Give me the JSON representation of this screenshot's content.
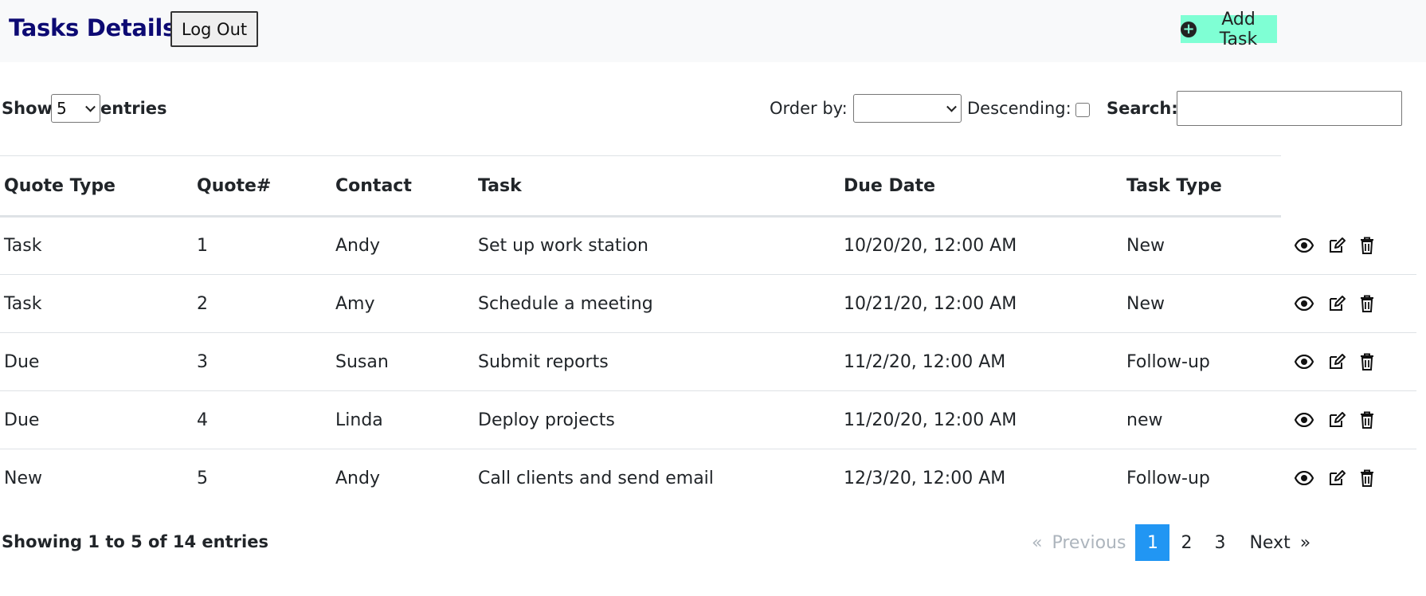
{
  "header": {
    "title": "Tasks Details",
    "logout_label": "Log Out",
    "add_task_label": "Add Task",
    "add_task_color": "#7fffd4",
    "title_color": "#0d0a73"
  },
  "controls": {
    "show_label": "Show",
    "entries_value": "5",
    "entries_label": "entries",
    "order_by_label": "Order by:",
    "order_by_value": "",
    "descending_label": "Descending:",
    "descending_checked": false,
    "search_label": "Search:",
    "search_value": ""
  },
  "table": {
    "columns": [
      "Quote Type",
      "Quote#",
      "Contact",
      "Task",
      "Due Date",
      "Task Type"
    ],
    "rows": [
      [
        "Task",
        "1",
        "Andy",
        "Set up work station",
        "10/20/20, 12:00 AM",
        "New"
      ],
      [
        "Task",
        "2",
        "Amy",
        "Schedule a meeting",
        "10/21/20, 12:00 AM",
        "New"
      ],
      [
        "Due",
        "3",
        "Susan",
        "Submit reports",
        "11/2/20, 12:00 AM",
        "Follow-up"
      ],
      [
        "Due",
        "4",
        "Linda",
        "Deploy projects",
        "11/20/20, 12:00 AM",
        "new"
      ],
      [
        "New",
        "5",
        "Andy",
        "Call clients and send email",
        "12/3/20, 12:00 AM",
        "Follow-up"
      ]
    ],
    "row_actions": [
      "eye-icon",
      "edit-icon",
      "trash-icon"
    ]
  },
  "footer": {
    "info": "Showing 1 to 5 of 14 entries",
    "first_symbol": "«",
    "previous_label": "Previous",
    "pages": [
      "1",
      "2",
      "3"
    ],
    "active_page": "1",
    "next_label": "Next",
    "last_symbol": "»",
    "active_color": "#2196f3"
  }
}
